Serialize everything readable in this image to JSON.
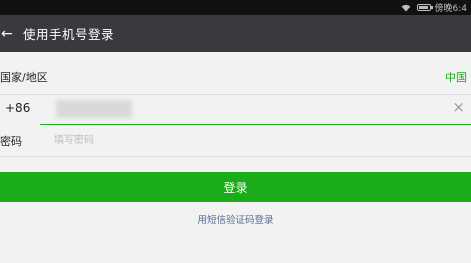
{
  "status_bar": {
    "time": "傍晚6:4",
    "icons": [
      "wifi-icon",
      "battery-icon"
    ]
  },
  "header": {
    "back_icon": "back-arrow-icon",
    "back_glyph": "←",
    "title": "使用手机号登录"
  },
  "form": {
    "region_label": "国家/地区",
    "region_value": "中国",
    "phone_code": "+86",
    "phone_value": "",
    "clear_glyph": "×",
    "password_label": "密码",
    "password_placeholder": "填写密码"
  },
  "actions": {
    "login_label": "登录",
    "sms_login_label": "用短信验证码登录"
  },
  "colors": {
    "accent": "#1aad19",
    "title_bar": "#393a3f",
    "link": "#576b95"
  }
}
